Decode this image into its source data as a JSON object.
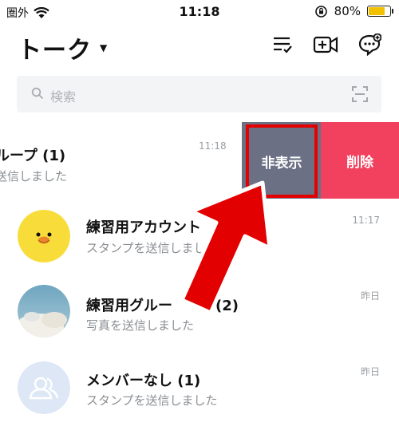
{
  "status_bar": {
    "carrier": "圏外",
    "time": "11:18",
    "battery_percent": "80%",
    "battery_level": 0.8
  },
  "header": {
    "title": "トーク",
    "icons": [
      "caret-down-icon",
      "list-check-icon",
      "video-plus-icon",
      "chat-plus-icon"
    ]
  },
  "search": {
    "placeholder": "検索"
  },
  "swiped_chat": {
    "name": "ループ (1)",
    "message": "送信しました",
    "time": "11:18",
    "hide_label": "非表示",
    "delete_label": "削除"
  },
  "chats": [
    {
      "name": "練習用アカウント",
      "message": "スタンプを送信しました",
      "time": "11:17"
    },
    {
      "name": "練習用グルー",
      "count": "(2)",
      "message": "写真を送信しました",
      "time": "昨日"
    },
    {
      "name": "メンバーなし (1)",
      "message": "スタンプを送信しました",
      "time": "昨日"
    }
  ],
  "colors": {
    "hide_bg": "#6b7085",
    "delete_bg": "#f2415e",
    "highlight_red": "#e30000",
    "battery_yellow": "#f2c200"
  }
}
